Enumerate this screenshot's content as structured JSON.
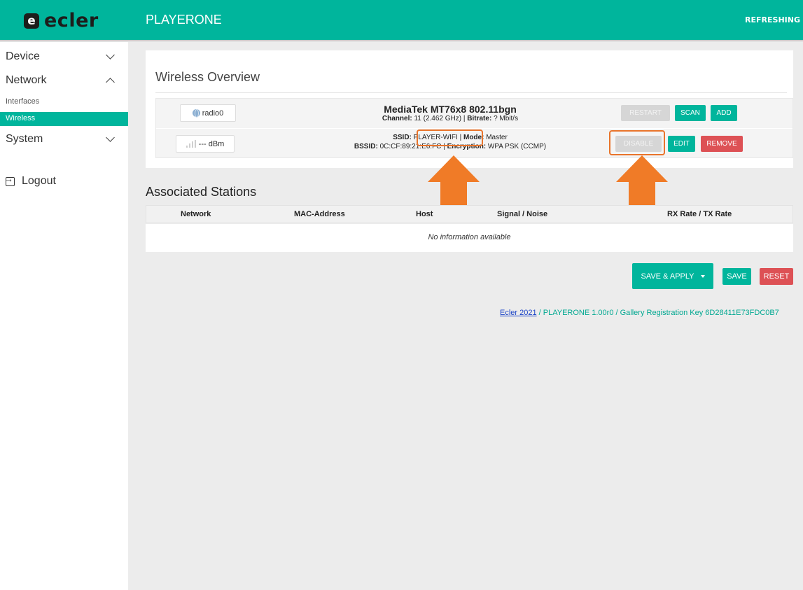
{
  "header": {
    "logo_mark": "e",
    "logo_text": "ecler",
    "app_title": "PLAYERONE",
    "status": "REFRESHING"
  },
  "sidebar": {
    "device": "Device",
    "network": "Network",
    "interfaces": "Interfaces",
    "wireless": "Wireless",
    "system": "System",
    "logout": "Logout"
  },
  "wireless_overview": {
    "title": "Wireless Overview",
    "radio": {
      "label": "radio0",
      "device_name": "MediaTek MT76x8 802.11bgn",
      "channel_label": "Channel:",
      "channel_value": "11 (2.462 GHz)",
      "bitrate_label": "Bitrate:",
      "bitrate_value": "? Mbit/s",
      "sep": "|",
      "restart": "RESTART",
      "scan": "SCAN",
      "add": "ADD"
    },
    "network": {
      "signal": "--- dBm",
      "ssid_label": "SSID:",
      "ssid_value": "PLAYER-WIFI",
      "mode_label": "Mode:",
      "mode_value": "Master",
      "bssid_label": "BSSID:",
      "bssid_value": "0C:CF:89:21:E6:FC",
      "encryption_label": "Encryption:",
      "encryption_value": "WPA PSK (CCMP)",
      "sep": "|",
      "disable": "DISABLE",
      "edit": "EDIT",
      "remove": "REMOVE"
    }
  },
  "associated_stations": {
    "title": "Associated Stations",
    "columns": [
      "Network",
      "MAC-Address",
      "Host",
      "Signal / Noise",
      "RX Rate / TX Rate"
    ],
    "empty_text": "No information available"
  },
  "actions": {
    "save_apply": "SAVE & APPLY",
    "save": "SAVE",
    "reset": "RESET"
  },
  "footer": {
    "link_text": "Ecler 2021",
    "rest_text": " / PLAYERONE 1.00r0 / Gallery Registration Key 6D28411E73FDC0B7"
  },
  "colors": {
    "accent": "#00b59c",
    "danger": "#dd5155",
    "highlight": "#f07b27"
  }
}
